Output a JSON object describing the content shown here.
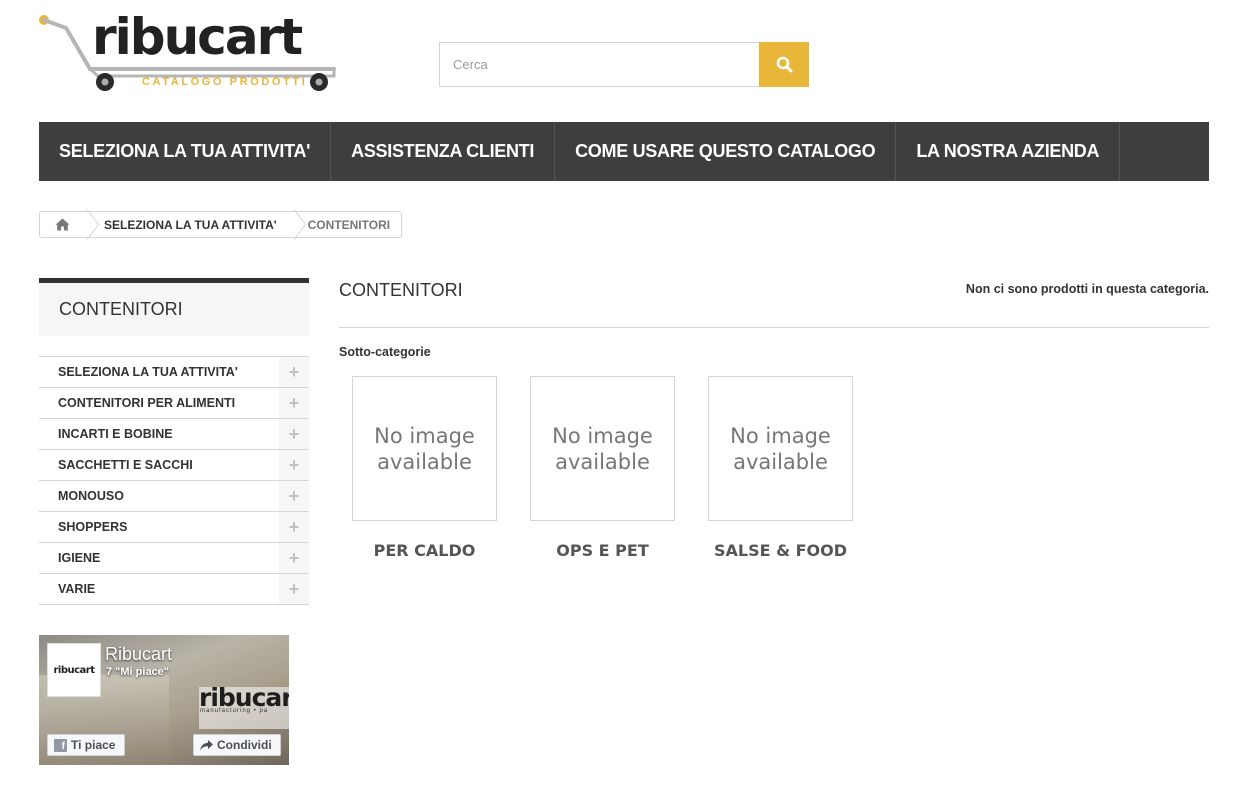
{
  "header": {
    "logo_word": "ribucart",
    "logo_sub": "CATALOGO PRODOTTI",
    "search": {
      "placeholder": "Cerca",
      "value": ""
    },
    "search_icon": "magnifier-icon",
    "accent": "#e8b739"
  },
  "nav": {
    "items": [
      {
        "label": "SELEZIONA LA TUA ATTIVITA'"
      },
      {
        "label": "ASSISTENZA CLIENTI"
      },
      {
        "label": "COME USARE QUESTO CATALOGO"
      },
      {
        "label": "LA NOSTRA AZIENDA"
      }
    ]
  },
  "breadcrumb": {
    "home_icon": "home-icon",
    "link": "SELEZIONA LA TUA ATTIVITA'",
    "current": "CONTENITORI"
  },
  "sidebar": {
    "title": "CONTENITORI",
    "items": [
      {
        "label": "SELEZIONA LA TUA ATTIVITA'",
        "toggle": "+"
      },
      {
        "label": "CONTENITORI PER ALIMENTI",
        "toggle": "+"
      },
      {
        "label": "INCARTI E BOBINE",
        "toggle": "+"
      },
      {
        "label": "SACCHETTI E SACCHI",
        "toggle": "+"
      },
      {
        "label": "MONOUSO",
        "toggle": "+"
      },
      {
        "label": "SHOPPERS",
        "toggle": "+"
      },
      {
        "label": "IGIENE",
        "toggle": "+"
      },
      {
        "label": "VARIE",
        "toggle": "+"
      }
    ]
  },
  "facebook": {
    "page_name": "Ribucart",
    "likes": "7 \"Mi piace\"",
    "thumb_text": "ribucart",
    "brand_text": "ribucart",
    "brand_sub": "manufacturing • pa",
    "like_label": "Ti piace",
    "share_label": "Condividi"
  },
  "main": {
    "title": "CONTENITORI",
    "no_products": "Non ci sono prodotti in questa categoria.",
    "subcat_heading": "Sotto-categorie",
    "subcategories": [
      {
        "image_text": "No image available",
        "name": "PER CALDO"
      },
      {
        "image_text": "No image available",
        "name": "OPS E PET"
      },
      {
        "image_text": "No image available",
        "name": "SALSE & FOOD"
      }
    ]
  }
}
